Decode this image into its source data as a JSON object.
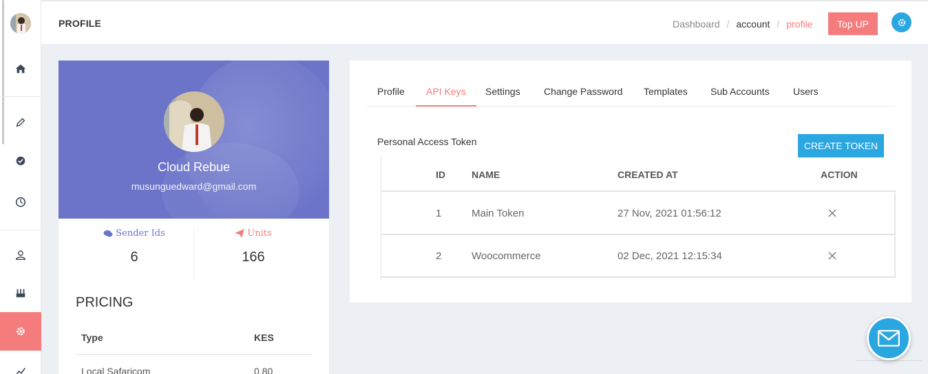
{
  "header": {
    "title": "PROFILE",
    "breadcrumbs": [
      "Dashboard",
      "account",
      "profile"
    ],
    "breadcrumb_separator": "/",
    "topup_label": "Top UP",
    "settings_icon": "gear-icon"
  },
  "sidebar": {
    "items": [
      {
        "icon": "home-icon"
      },
      {
        "icon": "pencil-icon"
      },
      {
        "icon": "check-circle-icon"
      },
      {
        "icon": "timer-icon"
      },
      {
        "icon": "user-icon"
      },
      {
        "icon": "factory-icon"
      },
      {
        "icon": "gear-icon",
        "active": true
      },
      {
        "icon": "chart-line-icon"
      }
    ]
  },
  "profile": {
    "name": "Cloud Rebue",
    "email": "musunguedward@gmail.com",
    "stats": [
      {
        "label": "Sender Ids",
        "value": "6",
        "color": "#6b74c9",
        "icon": "comments-icon"
      },
      {
        "label": "Units",
        "value": "166",
        "color": "#f57c7c",
        "icon": "paper-plane-icon"
      }
    ]
  },
  "pricing": {
    "title": "PRICING",
    "columns": [
      "Type",
      "KES"
    ],
    "rows": [
      {
        "type": "Local Safaricom",
        "kes": "0.80"
      }
    ]
  },
  "tabs": [
    {
      "label": "Profile"
    },
    {
      "label": "API Keys",
      "active": true
    },
    {
      "label": "Settings"
    },
    {
      "label": "Change Password"
    },
    {
      "label": "Templates"
    },
    {
      "label": "Sub Accounts"
    },
    {
      "label": "Users"
    }
  ],
  "tokens": {
    "title": "Personal Access Token",
    "create_label": "CREATE TOKEN",
    "columns": [
      "ID",
      "NAME",
      "CREATED AT",
      "ACTION"
    ],
    "rows": [
      {
        "id": "1",
        "name": "Main Token",
        "created_at": "27 Nov, 2021 01:56:12"
      },
      {
        "id": "2",
        "name": "Woocommerce",
        "created_at": "02 Dec, 2021 12:15:34"
      }
    ]
  },
  "colors": {
    "accent": "#f57c7c",
    "primary": "#2aa6e0",
    "cover": "#6b74c9"
  }
}
